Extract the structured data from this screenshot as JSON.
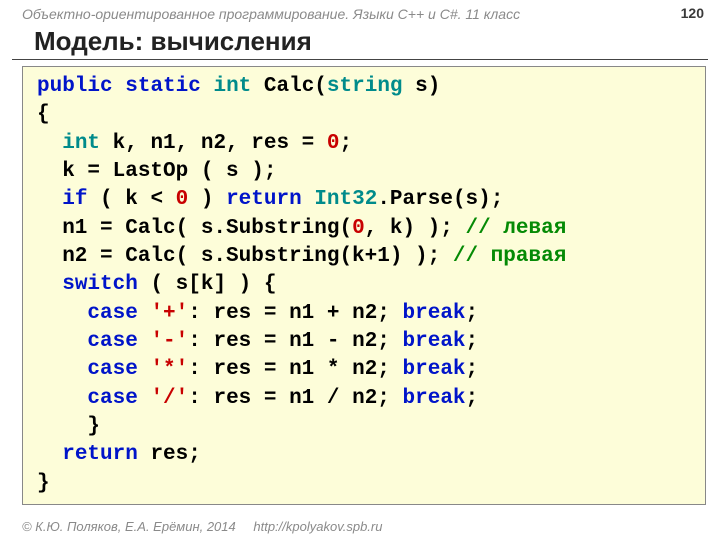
{
  "header": "Объектно-ориентированное программирование. Языки C++ и C#. 11 класс",
  "pagenum": "120",
  "title": "Модель: вычисления",
  "footer": {
    "copyright": "© К.Ю. Поляков, Е.А. Ерёмин, 2014",
    "url": "http://kpolyakov.spb.ru"
  },
  "code": {
    "l1": {
      "kw1": "public",
      "kw2": "static",
      "ty1": "int",
      "name": " Calc(",
      "ty2": "string",
      "rest": " s)"
    },
    "l2": "{",
    "l3": {
      "indent": "  ",
      "ty": "int",
      "rest": " k, n1, n2, res = ",
      "num": "0",
      "semi": ";"
    },
    "l4": "  k = LastOp ( s );",
    "l5": {
      "indent": "  ",
      "kw1": "if",
      "cond": " ( k < ",
      "num": "0",
      "after": " ) ",
      "kw2": "return",
      "sp": " ",
      "cls": "Int32",
      "rest": ".Parse(s);"
    },
    "l6": {
      "indent": "  n1 = Calc( s.Substring(",
      "num": "0",
      "after": ", k) ); ",
      "cm": "// левая"
    },
    "l7": {
      "indent": "  n2 = Calc( s.Substring(k+1) ); ",
      "cm": "// правая"
    },
    "l8": {
      "indent": "  ",
      "kw": "switch",
      "rest": " ( s[k] ) {"
    },
    "l9": {
      "indent": "    ",
      "kw1": "case",
      "sp": " ",
      "str": "'+'",
      "mid": ": res = n1 + n2; ",
      "kw2": "break",
      "semi": ";"
    },
    "l10": {
      "indent": "    ",
      "kw1": "case",
      "sp": " ",
      "str": "'-'",
      "mid": ": res = n1 - n2; ",
      "kw2": "break",
      "semi": ";"
    },
    "l11": {
      "indent": "    ",
      "kw1": "case",
      "sp": " ",
      "str": "'*'",
      "mid": ": res = n1 * n2; ",
      "kw2": "break",
      "semi": ";"
    },
    "l12": {
      "indent": "    ",
      "kw1": "case",
      "sp": " ",
      "str": "'/'",
      "mid": ": res = n1 / n2; ",
      "kw2": "break",
      "semi": ";"
    },
    "l13": "    }",
    "l14": {
      "indent": "  ",
      "kw": "return",
      "rest": " res;"
    },
    "l15": "}"
  }
}
